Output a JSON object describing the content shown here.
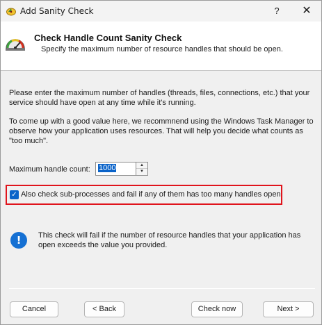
{
  "window": {
    "title": "Add Sanity Check",
    "help_label": "?",
    "close_label": "✕"
  },
  "header": {
    "title": "Check Handle Count Sanity Check",
    "subtitle": "Specify the maximum number of resource handles that should be open."
  },
  "body": {
    "para1": "Please enter the maximum number of handles (threads, files, connections, etc.) that your service should have open at any time while it's running.",
    "para2": "To come up with a good value here, we recommnend using the Windows Task Manager to observe how your application uses resources. That will help you decide what counts as \"too much\".",
    "max_label": "Maximum handle count:",
    "max_value": "1000",
    "checkbox_label": "Also check sub-processes and fail if any of them has too many handles open",
    "checkbox_checked": true,
    "info_text": "This check will fail if the number of resource handles that your application has open exceeds the value you provided."
  },
  "buttons": {
    "cancel": "Cancel",
    "back": "< Back",
    "check_now": "Check now",
    "next": "Next >"
  },
  "icons": {
    "app": "sanity-check-app-icon",
    "header": "gauge-icon",
    "info": "info-icon",
    "checkbox": "checkmark-icon"
  },
  "colors": {
    "accent": "#0a63c9",
    "highlight": "#e0141c",
    "info": "#1570d3"
  }
}
